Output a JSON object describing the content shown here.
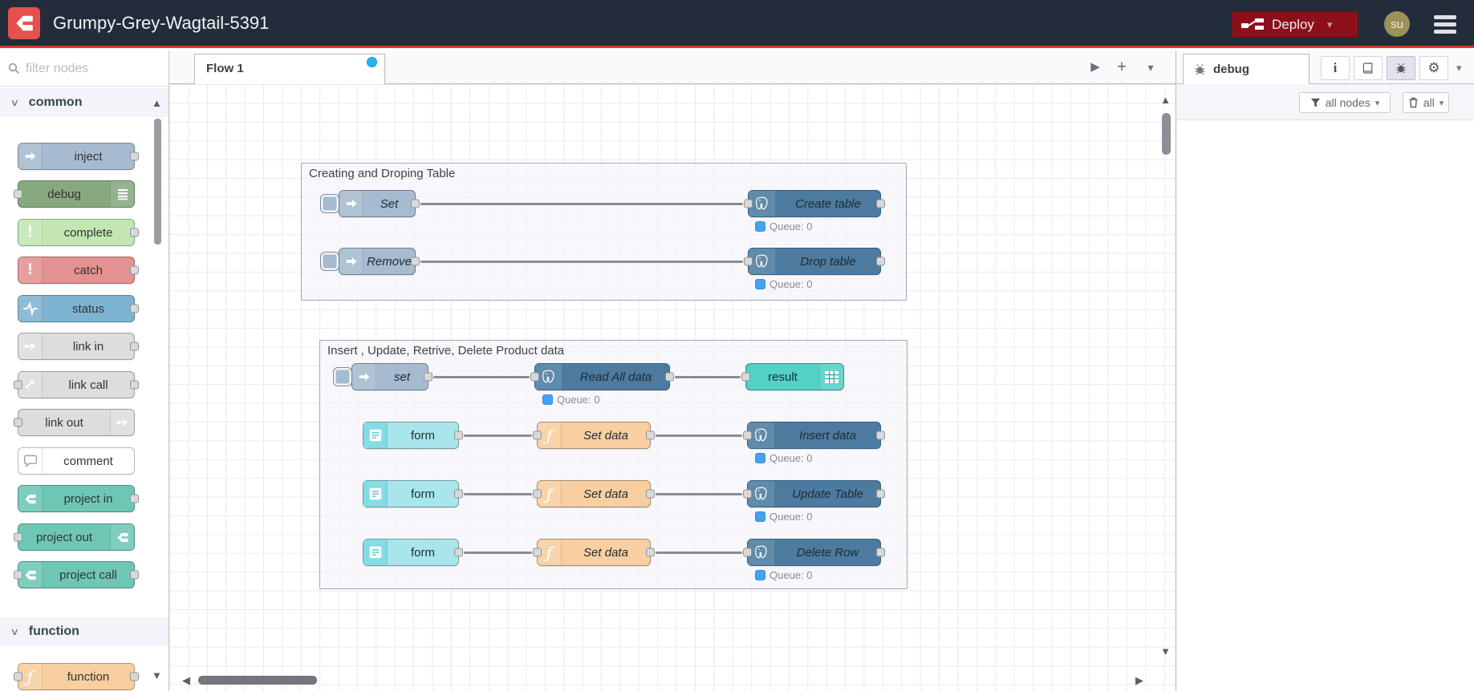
{
  "glyphs": {
    "chevron_down": "▾",
    "category_chevron": "∨",
    "caret_up": "▲",
    "caret_down": "▼",
    "caret_left": "◀",
    "caret_right": "▶",
    "play": "▶",
    "plus": "+",
    "gear": "⚙",
    "info": "i",
    "exclaim": "!",
    "function_f": "ƒ"
  },
  "colors": {
    "header_bg": "#222c3a",
    "header_underline": "#d7392e",
    "brand_red": "#e8504b",
    "deploy_bg": "#8C101C",
    "tab_dirty_dot": "#22b3ef",
    "status_dot_blue": "#45a1f2",
    "node_inject": "#a6bbcf",
    "node_debug": "#87a980",
    "node_complete": "#c3e7b3",
    "node_catch": "#e49191",
    "node_status": "#7fb3d2",
    "node_link": "#dddddd",
    "node_comment": "#ffffff",
    "node_project": "#6ec7b5",
    "node_function": "#f8cfa0",
    "node_postgresql": "#4c7b9f",
    "node_form": "#a9e6eb",
    "node_result": "#52d1c7"
  },
  "header": {
    "title": "Grumpy-Grey-Wagtail-5391",
    "deploy_label": "Deploy",
    "avatar_text": "su"
  },
  "palette": {
    "filter_placeholder": "filter nodes",
    "categories": [
      {
        "label": "common",
        "nodes": [
          {
            "label": "inject"
          },
          {
            "label": "debug"
          },
          {
            "label": "complete"
          },
          {
            "label": "catch"
          },
          {
            "label": "status"
          },
          {
            "label": "link in"
          },
          {
            "label": "link call"
          },
          {
            "label": "link out"
          },
          {
            "label": "comment"
          },
          {
            "label": "project in"
          },
          {
            "label": "project out"
          },
          {
            "label": "project call"
          }
        ]
      },
      {
        "label": "function",
        "nodes": [
          {
            "label": "function"
          }
        ]
      }
    ]
  },
  "workspace": {
    "tab": "Flow 1"
  },
  "flow": {
    "groups": [
      {
        "title": "Creating and Droping Table",
        "nodes": {
          "inject1": "Set",
          "pg1": "Create table",
          "status1": "Queue: 0",
          "inject2": "Remove",
          "pg2": "Drop table",
          "status2": "Queue: 0"
        }
      },
      {
        "title": "Insert , Update, Retrive, Delete Product data",
        "nodes": {
          "inject1": "set",
          "pg1": "Read All data",
          "status1": "Queue: 0",
          "debug1": "result",
          "form2": "form",
          "fn2": "Set data",
          "pg2": "Insert data",
          "status2": "Queue: 0",
          "form3": "form",
          "fn3": "Set data",
          "pg3": "Update Table",
          "status3": "Queue: 0",
          "form4": "form",
          "fn4": "Set data",
          "pg4": "Delete Row",
          "status4": "Queue: 0"
        }
      }
    ]
  },
  "sidebar": {
    "tab": "debug",
    "filter_button": "all nodes",
    "clear_button": "all"
  }
}
